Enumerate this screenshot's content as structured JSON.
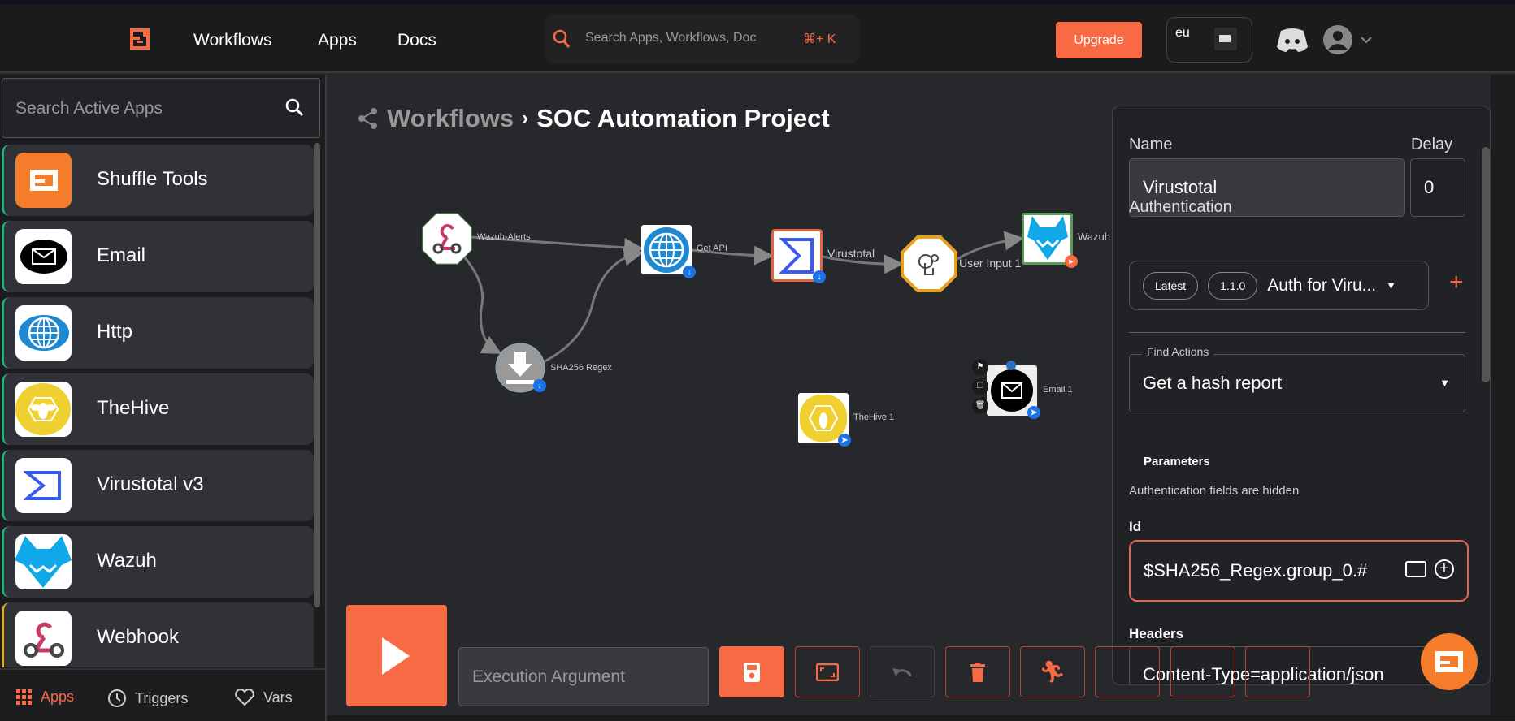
{
  "nav": {
    "links": [
      "Workflows",
      "Apps",
      "Docs"
    ],
    "search_placeholder": "Search Apps, Workflows, Doc",
    "shortcut": "⌘+ K",
    "upgrade": "Upgrade",
    "region": "eu"
  },
  "sidebar": {
    "search_placeholder": "Search Active Apps",
    "apps": [
      {
        "label": "Shuffle Tools"
      },
      {
        "label": "Email"
      },
      {
        "label": "Http"
      },
      {
        "label": "TheHive"
      },
      {
        "label": "Virustotal v3"
      },
      {
        "label": "Wazuh"
      },
      {
        "label": "Webhook"
      }
    ],
    "tabs": [
      "Apps",
      "Triggers",
      "Vars"
    ]
  },
  "breadcrumb": {
    "parent": "Workflows",
    "sep": "›",
    "title": "SOC Automation Project"
  },
  "nodes": {
    "webhook": "Wazuh-Alerts",
    "getapi": "Get API",
    "virustotal": "Virustotal",
    "userinput": "User Input 1",
    "wazuh": "Wazuh",
    "regex": "SHA256 Regex",
    "thehive": "TheHive 1",
    "email": "Email 1"
  },
  "panel": {
    "name_label": "Name",
    "name_value": "Virustotal",
    "delay_label": "Delay",
    "delay_value": "0",
    "auth_label": "Authentication",
    "chip_latest": "Latest",
    "chip_version": "1.1.0",
    "auth_value": "Auth for Viru...",
    "find_actions_label": "Find Actions",
    "action_value": "Get a hash report",
    "parameters": "Parameters",
    "auth_hidden": "Authentication fields are hidden",
    "id_label": "Id",
    "id_value": "$SHA256_Regex.group_0.#",
    "headers_label": "Headers",
    "headers_value": "Content-Type=application/json"
  },
  "toolbar": {
    "exec_placeholder": "Execution Argument"
  },
  "colors": {
    "accent": "#f86a43",
    "canvas": "#27282c"
  }
}
